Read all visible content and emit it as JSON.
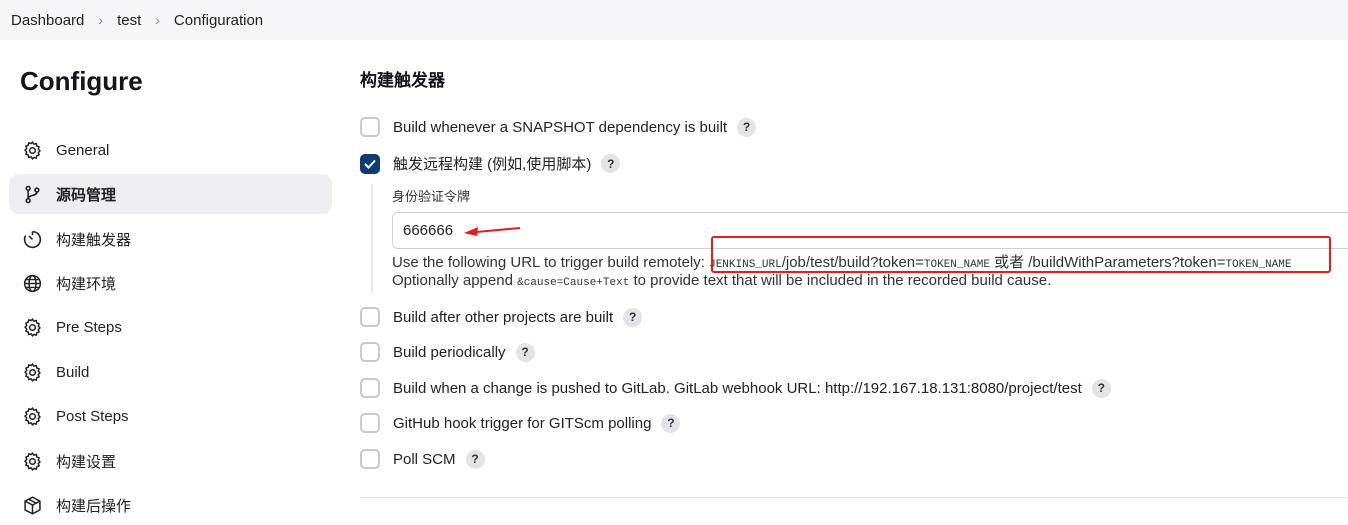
{
  "breadcrumb": [
    "Dashboard",
    "test",
    "Configuration"
  ],
  "sidebar": {
    "title": "Configure",
    "items": [
      {
        "label": "General",
        "icon": "gear-icon"
      },
      {
        "label": "源码管理",
        "icon": "branch-icon",
        "active": true
      },
      {
        "label": "构建触发器",
        "icon": "timer-icon"
      },
      {
        "label": "构建环境",
        "icon": "globe-icon"
      },
      {
        "label": "Pre Steps",
        "icon": "gear-icon"
      },
      {
        "label": "Build",
        "icon": "gear-icon"
      },
      {
        "label": "Post Steps",
        "icon": "gear-icon"
      },
      {
        "label": "构建设置",
        "icon": "gear-icon"
      },
      {
        "label": "构建后操作",
        "icon": "package-icon"
      }
    ]
  },
  "main": {
    "section_title": "构建触发器",
    "triggers": {
      "snapshot": {
        "label": "Build whenever a SNAPSHOT dependency is built",
        "checked": false
      },
      "remote": {
        "label": "触发远程构建 (例如,使用脚本)",
        "checked": true
      },
      "after_other": {
        "label": "Build after other projects are built",
        "checked": false
      },
      "periodically": {
        "label": "Build periodically",
        "checked": false
      },
      "gitlab": {
        "label": "Build when a change is pushed to GitLab. GitLab webhook URL: http://192.167.18.131:8080/project/test",
        "checked": false
      },
      "github": {
        "label": "GitHub hook trigger for GITScm polling",
        "checked": false
      },
      "pollscm": {
        "label": "Poll SCM",
        "checked": false
      }
    },
    "token": {
      "label": "身份验证令牌",
      "value": "666666"
    },
    "url_help": {
      "prefix": "Use the following URL to trigger build remotely: ",
      "jenkins_url": "JENKINS_URL",
      "path1": "/job/test/build?token=",
      "token_name1": "TOKEN_NAME",
      "or_text": " 或者 ",
      "path2": "/buildWithParameters?token=",
      "token_name2": "TOKEN_NAME",
      "append_prefix": "Optionally append ",
      "append_code": "&cause=Cause+Text",
      "append_suffix": " to provide text that will be included in the recorded build cause."
    },
    "help_glyph": "?",
    "accent_color": "#0f3b6e",
    "annotation_color": "#e02020"
  }
}
